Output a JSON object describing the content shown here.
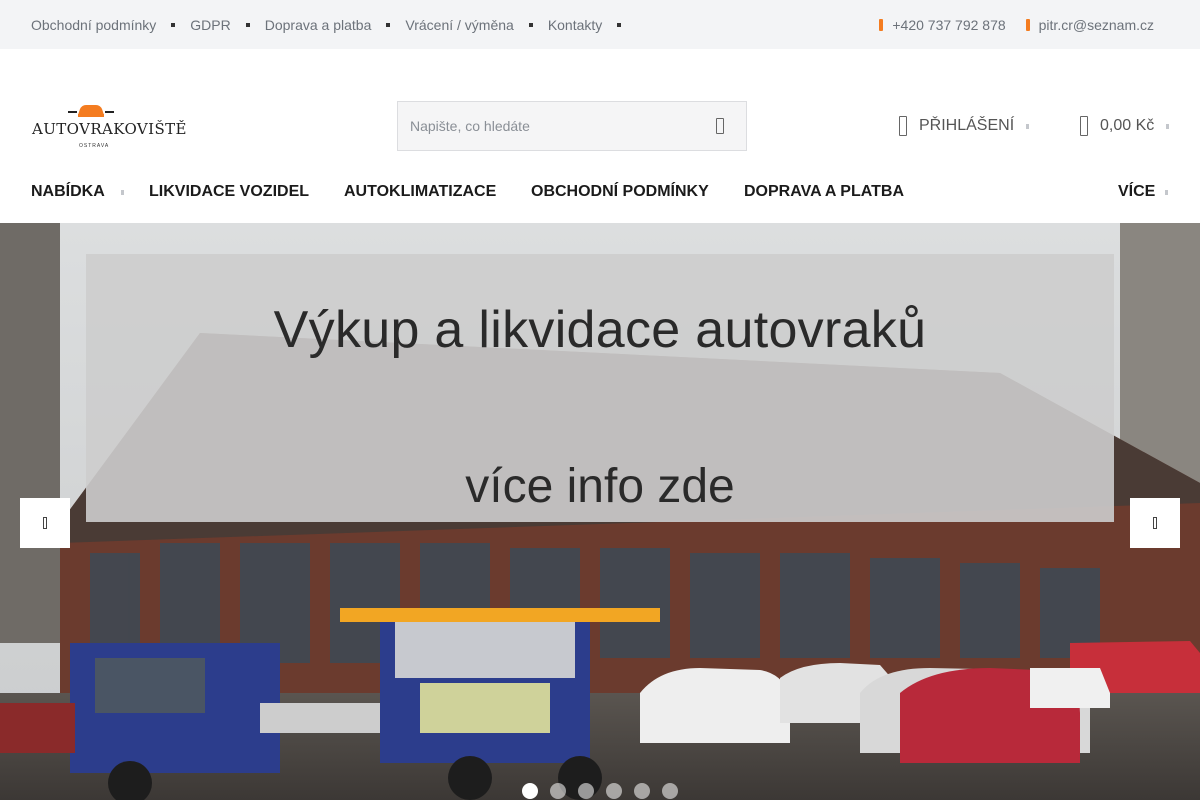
{
  "topbar": {
    "links": [
      "Obchodní podmínky",
      "GDPR",
      "Doprava a platba",
      "Vrácení / výměna",
      "Kontakty"
    ],
    "phone": "+420 737 792 878",
    "email": "pitr.cr@seznam.cz",
    "phone_icon": "phone-icon",
    "email_icon": "mail-icon"
  },
  "header": {
    "logo_text": "AUTOVRAKOVIŠTĚ",
    "logo_subtext": "OSTRAVA",
    "search_placeholder": "Napište, co hledáte",
    "search_icon": "search-icon",
    "login_label": "PŘIHLÁŠENÍ",
    "cart_label": "0,00 Kč"
  },
  "nav": {
    "items": [
      "NABÍDKA",
      "LIKVIDACE VOZIDEL",
      "AUTOKLIMATIZACE",
      "OBCHODNÍ PODMÍNKY",
      "DOPRAVA A PLATBA"
    ],
    "more_label": "VÍCE"
  },
  "banner": {
    "headline": "Výkup a likvidace autovraků",
    "subline": "více info zde",
    "slide_count": 6,
    "active_slide": 1
  },
  "colors": {
    "accent": "#f47c20",
    "topbar_bg": "#f3f4f6",
    "nav_text": "#1b1b1b"
  }
}
